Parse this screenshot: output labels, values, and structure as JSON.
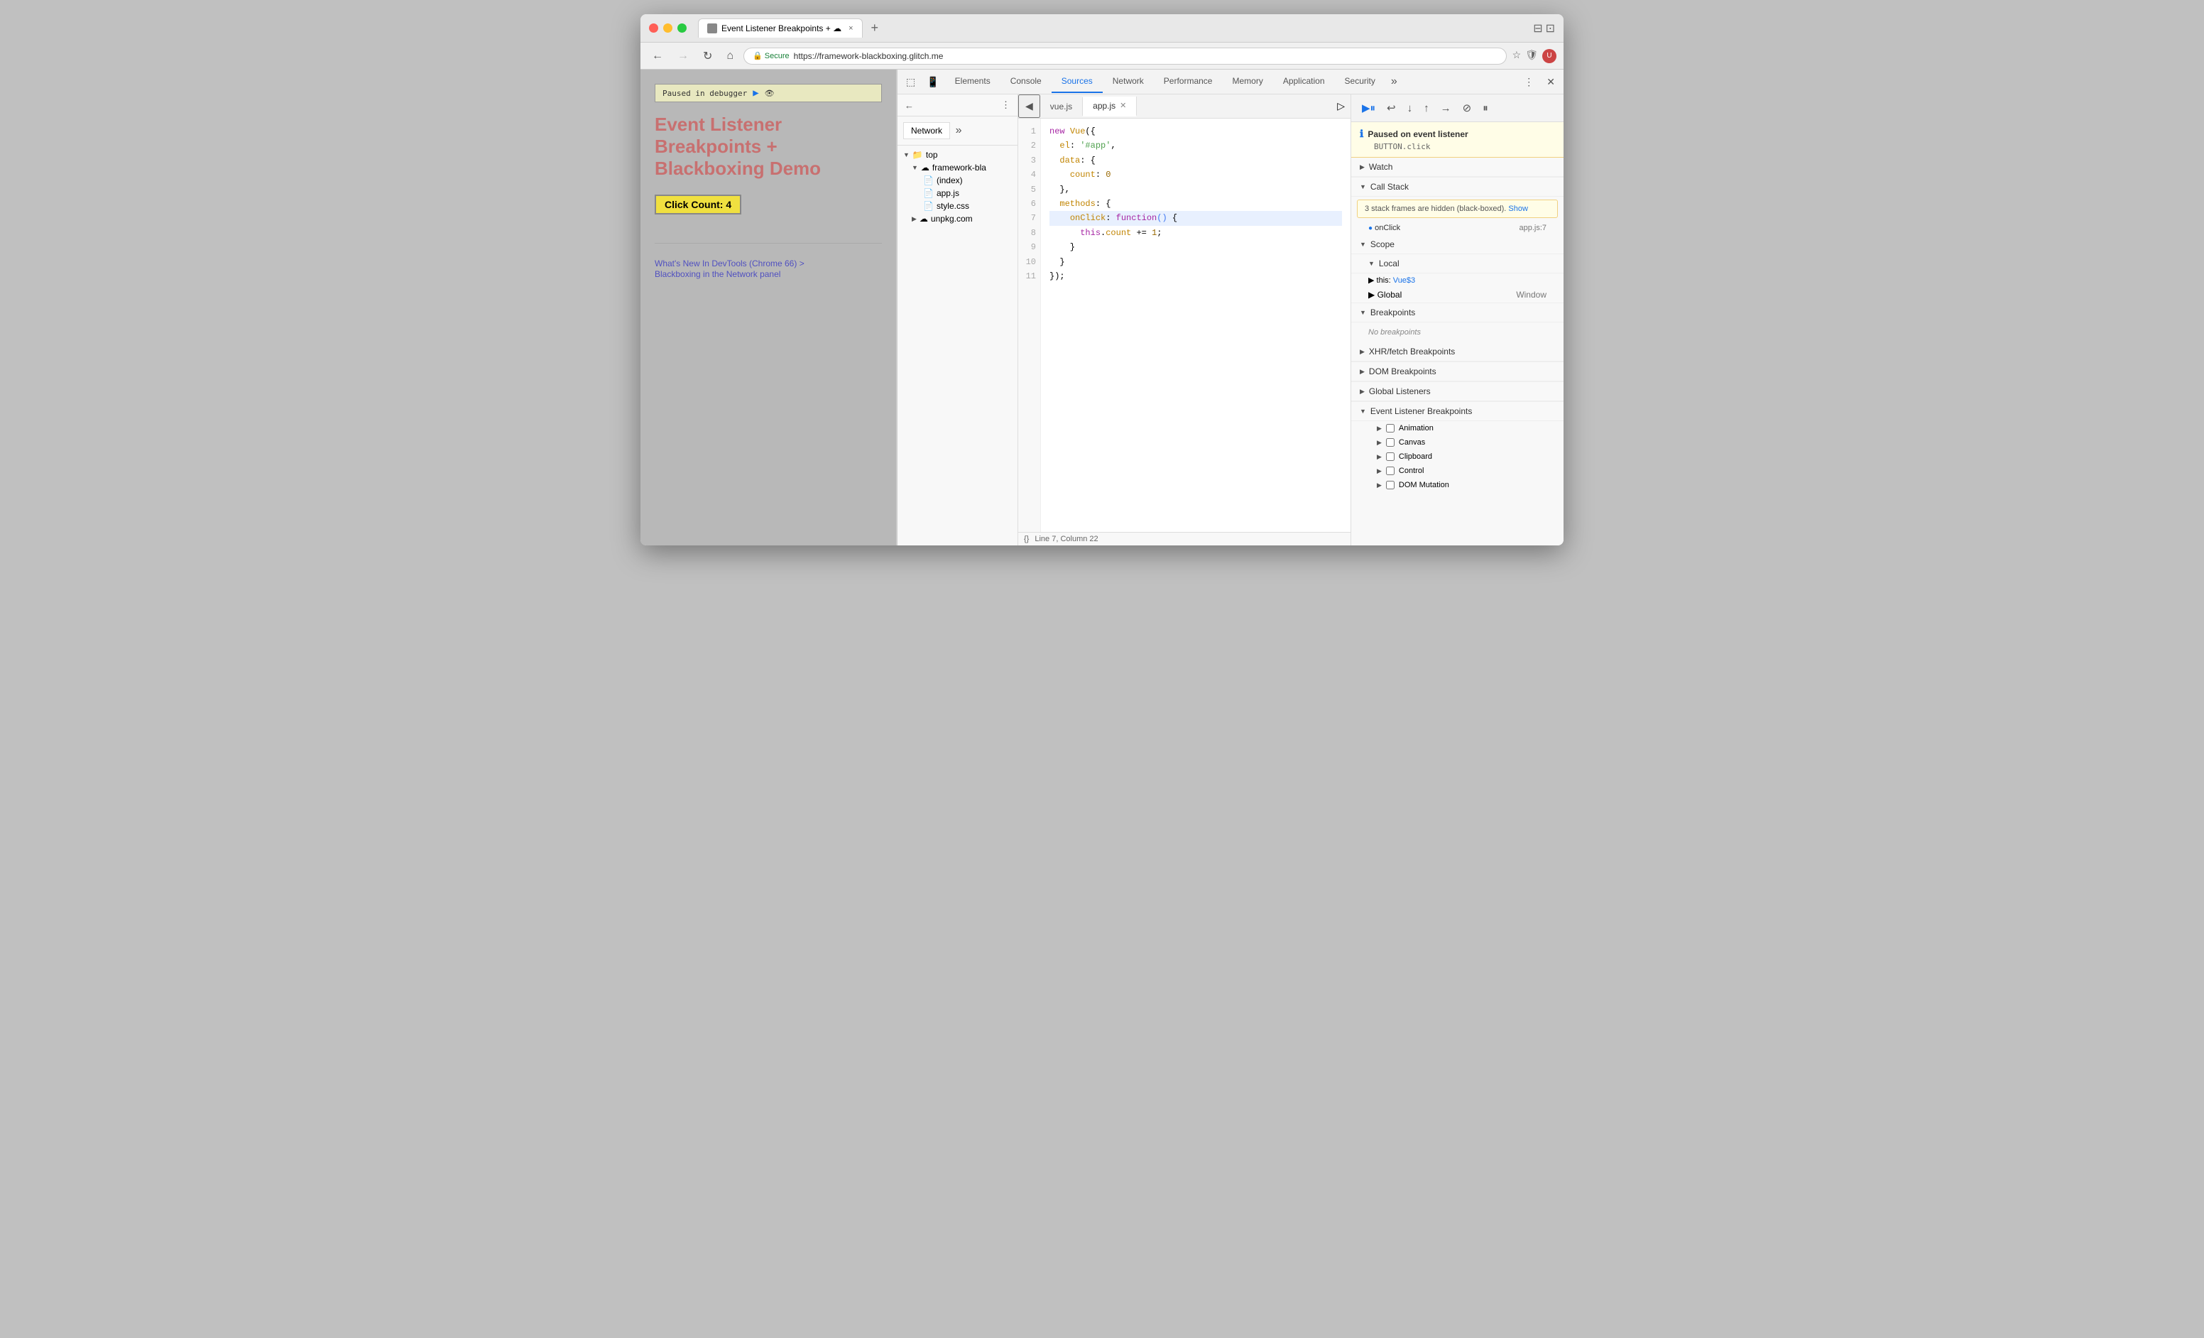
{
  "browser": {
    "tab_title": "Event Listener Breakpoints + ☁",
    "tab_close": "×",
    "address": "https://framework-blackboxing.glitch.me",
    "secure_label": "Secure",
    "new_tab": "+"
  },
  "page": {
    "debugger_banner": "Paused in debugger",
    "title": "Event Listener Breakpoints + Blackboxing Demo",
    "counter_label": "Click Count: 4",
    "link1": "What's New In DevTools (Chrome 66) >",
    "link2": "Blackboxing in the Network panel"
  },
  "devtools": {
    "tabs": [
      "Elements",
      "Console",
      "Sources",
      "Network",
      "Performance",
      "Memory",
      "Application",
      "Security"
    ],
    "active_tab": "Sources"
  },
  "file_tree": {
    "network_label": "Network",
    "top_label": "top",
    "framework_label": "framework-bla",
    "index_label": "(index)",
    "appjs_label": "app.js",
    "stylecss_label": "style.css",
    "unpkg_label": "unpkg.com"
  },
  "editor": {
    "tabs": [
      "vue.js",
      "app.js"
    ],
    "active_tab": "app.js",
    "status_line": 7,
    "status_col": 22,
    "status_label": "Line 7, Column 22",
    "code_lines": [
      {
        "num": 1,
        "text": "new Vue({",
        "highlight": false
      },
      {
        "num": 2,
        "text": "  el: '#app',",
        "highlight": false
      },
      {
        "num": 3,
        "text": "  data: {",
        "highlight": false
      },
      {
        "num": 4,
        "text": "    count: 0",
        "highlight": false
      },
      {
        "num": 5,
        "text": "  },",
        "highlight": false
      },
      {
        "num": 6,
        "text": "  methods: {",
        "highlight": false
      },
      {
        "num": 7,
        "text": "    onClick: function() {",
        "highlight": true
      },
      {
        "num": 8,
        "text": "      this.count += 1;",
        "highlight": false
      },
      {
        "num": 9,
        "text": "    }",
        "highlight": false
      },
      {
        "num": 10,
        "text": "  }",
        "highlight": false
      },
      {
        "num": 11,
        "text": "});",
        "highlight": false
      }
    ]
  },
  "right_panel": {
    "paused_title": "Paused on event listener",
    "paused_detail": "BUTTON.click",
    "watch_label": "Watch",
    "call_stack_label": "Call Stack",
    "blackbox_warning": "3 stack frames are hidden (black-boxed).",
    "blackbox_link": "Show",
    "onclick_label": "onClick",
    "onclick_location": "app.js:7",
    "scope_label": "Scope",
    "local_label": "Local",
    "this_label": "this:",
    "this_val": "Vue$3",
    "global_label": "Global",
    "global_val": "Window",
    "breakpoints_label": "Breakpoints",
    "no_breakpoints": "No breakpoints",
    "xhr_label": "XHR/fetch Breakpoints",
    "dom_label": "DOM Breakpoints",
    "global_listeners_label": "Global Listeners",
    "event_listener_label": "Event Listener Breakpoints",
    "animation_label": "Animation",
    "canvas_label": "Canvas",
    "clipboard_label": "Clipboard",
    "control_label": "Control",
    "dom_mutation_label": "DOM Mutation"
  }
}
